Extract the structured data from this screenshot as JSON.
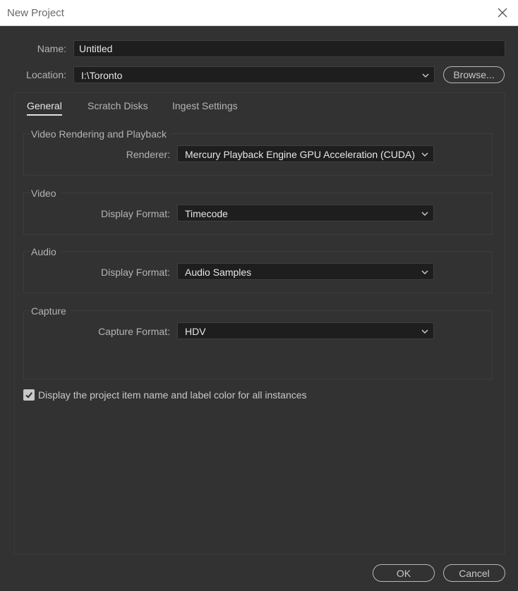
{
  "window": {
    "title": "New Project"
  },
  "name_row": {
    "label": "Name:",
    "value": "Untitled"
  },
  "location_row": {
    "label": "Location:",
    "value": "I:\\Toronto",
    "browse_label": "Browse..."
  },
  "tabs": [
    {
      "label": "General",
      "active": true
    },
    {
      "label": "Scratch Disks",
      "active": false
    },
    {
      "label": "Ingest Settings",
      "active": false
    }
  ],
  "groups": {
    "rendering": {
      "title": "Video Rendering and Playback",
      "field_label": "Renderer:",
      "value": "Mercury Playback Engine GPU Acceleration (CUDA)"
    },
    "video": {
      "title": "Video",
      "field_label": "Display Format:",
      "value": "Timecode"
    },
    "audio": {
      "title": "Audio",
      "field_label": "Display Format:",
      "value": "Audio Samples"
    },
    "capture": {
      "title": "Capture",
      "field_label": "Capture Format:",
      "value": "HDV"
    }
  },
  "display_option": {
    "label": "Display the project item name and label color for all instances",
    "checked": true
  },
  "buttons": {
    "ok": "OK",
    "cancel": "Cancel"
  },
  "colors": {
    "background": "#323232",
    "field": "#1e1e1e",
    "titlebar": "#ffffff"
  },
  "icons": {
    "close": "close-icon",
    "dropdown": "chevron-down-icon",
    "check": "checkmark-icon"
  }
}
